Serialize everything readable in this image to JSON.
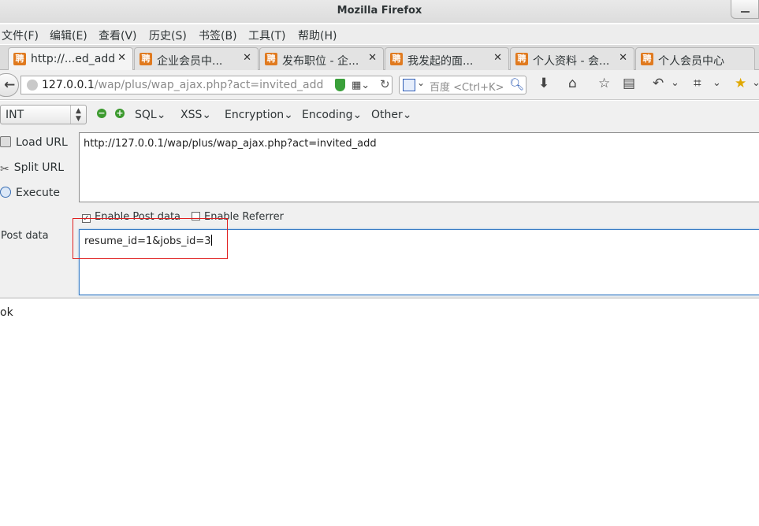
{
  "window": {
    "title": "Mozilla Firefox"
  },
  "menu": [
    "文件(F)",
    "编辑(E)",
    "查看(V)",
    "历史(S)",
    "书签(B)",
    "工具(T)",
    "帮助(H)"
  ],
  "tabs": [
    {
      "label": "http://...ed_add",
      "active": true
    },
    {
      "label": "企业会员中...",
      "active": false
    },
    {
      "label": "发布职位 - 企...",
      "active": false
    },
    {
      "label": "我发起的面...",
      "active": false
    },
    {
      "label": "个人资料 - 会...",
      "active": false
    },
    {
      "label": "个人会员中心",
      "active": false
    }
  ],
  "tab_favicon_text": "聘",
  "nav": {
    "url_host": "127.0.0.1",
    "url_path": "/wap/plus/wap_ajax.php?act=invited_add",
    "search_placeholder": "百度 <Ctrl+K>"
  },
  "hackbar": {
    "type_select": "INT",
    "menus": [
      "SQL",
      "XSS",
      "Encryption",
      "Encoding",
      "Other"
    ],
    "buttons": {
      "load": "Load URL",
      "split": "Split URL",
      "execute": "Execute"
    },
    "url_value": "http://127.0.0.1/wap/plus/wap_ajax.php?act=invited_add",
    "enable_post_label": "Enable Post data",
    "enable_post_checked": true,
    "enable_referrer_label": "Enable Referrer",
    "enable_referrer_checked": false,
    "post_label": "Post data",
    "post_value": "resume_id=1&jobs_id=3"
  },
  "page": {
    "response_text": "ok"
  },
  "colors": {
    "highlight_box": "#e02020",
    "favicon": "#e07a1f",
    "accent_green": "#3c9a2e"
  }
}
